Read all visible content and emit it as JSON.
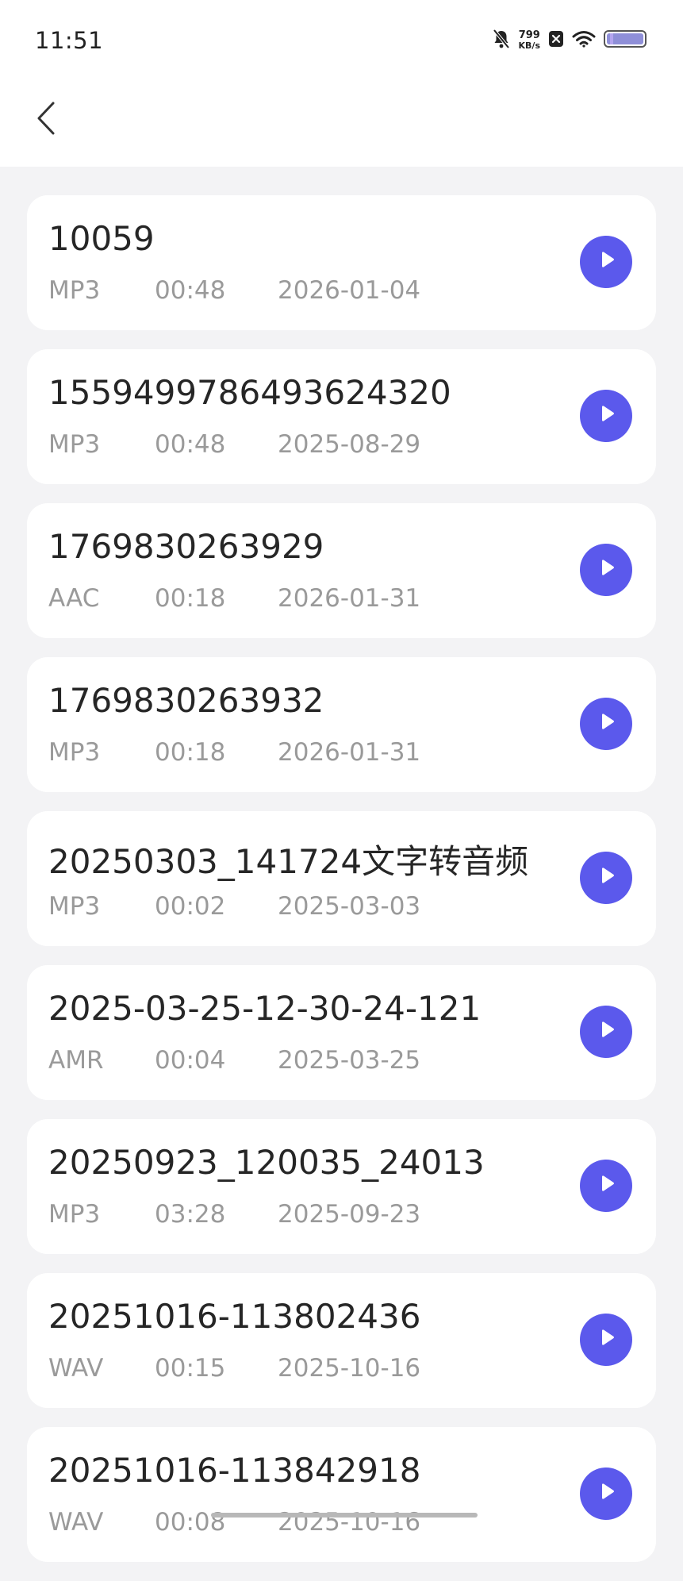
{
  "status_bar": {
    "time": "11:51",
    "net_speed_value": "799",
    "net_speed_unit": "KB/s",
    "icons": [
      "mute-bell-icon",
      "sim-blocked-icon",
      "wifi-icon",
      "battery-icon"
    ]
  },
  "header": {
    "back_icon": "chevron-left-icon"
  },
  "colors": {
    "accent": "#5b59ec",
    "background": "#f3f3f5",
    "card": "#ffffff",
    "meta_text": "#9a9a9a"
  },
  "files": [
    {
      "title": "10059",
      "format": "MP3",
      "duration": "00:48",
      "date": "2026-01-04"
    },
    {
      "title": "1559499786493624320",
      "format": "MP3",
      "duration": "00:48",
      "date": "2025-08-29"
    },
    {
      "title": "1769830263929",
      "format": "AAC",
      "duration": "00:18",
      "date": "2026-01-31"
    },
    {
      "title": "1769830263932",
      "format": "MP3",
      "duration": "00:18",
      "date": "2026-01-31"
    },
    {
      "title": "20250303_141724文字转音频",
      "format": "MP3",
      "duration": "00:02",
      "date": "2025-03-03"
    },
    {
      "title": "2025-03-25-12-30-24-121",
      "format": "AMR",
      "duration": "00:04",
      "date": "2025-03-25"
    },
    {
      "title": "20250923_120035_24013",
      "format": "MP3",
      "duration": "03:28",
      "date": "2025-09-23"
    },
    {
      "title": "20251016-113802436",
      "format": "WAV",
      "duration": "00:15",
      "date": "2025-10-16"
    },
    {
      "title": "20251016-113842918",
      "format": "WAV",
      "duration": "00:08",
      "date": "2025-10-16"
    }
  ]
}
